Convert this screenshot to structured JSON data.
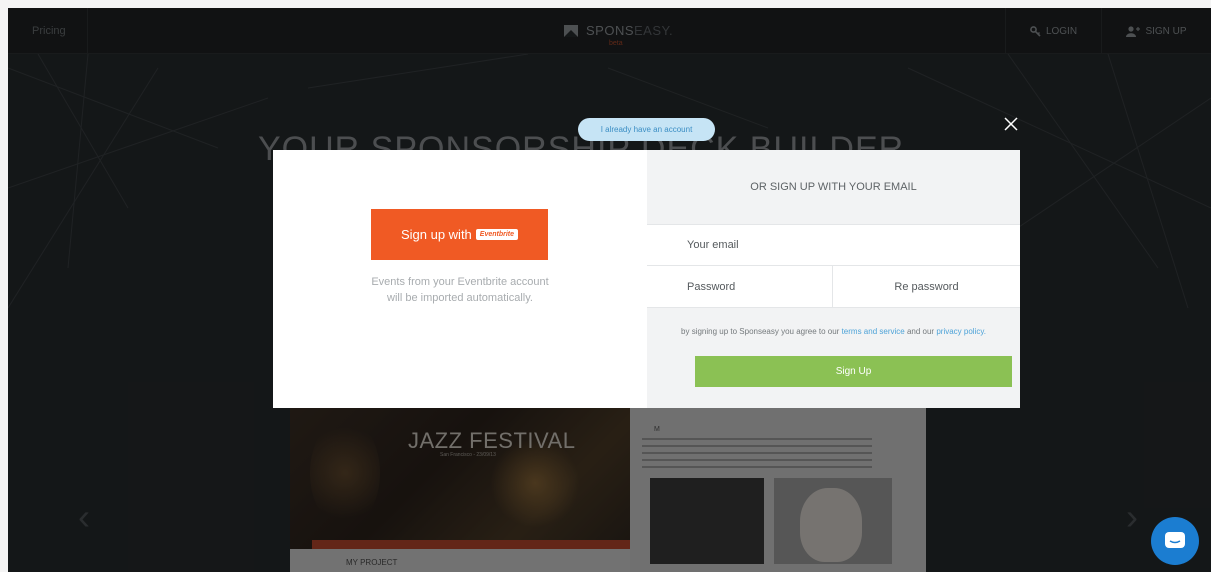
{
  "nav": {
    "pricing_label": "Pricing",
    "logo_text_bold": "SPONS",
    "logo_text_light": "EASY.",
    "logo_beta": "beta",
    "login_label": "LOGIN",
    "signup_label": "SIGN UP"
  },
  "hero": {
    "title": "YOUR SPONSORSHIP DECK BUILDER"
  },
  "preview": {
    "event_title": "JAZZ FESTIVAL",
    "event_subtitle": "San Francisco - 23/09/13",
    "project_label": "MY PROJECT"
  },
  "modal": {
    "already_account_label": "I already have an account",
    "eventbrite_button_label": "Sign up with",
    "eventbrite_badge": "Eventbrite",
    "eventbrite_desc_line1": "Events from your Eventbrite account",
    "eventbrite_desc_line2": "will be imported automatically.",
    "or_email_header": "OR SIGN UP WITH YOUR EMAIL",
    "email_placeholder": "Your email",
    "password_placeholder": "Password",
    "repassword_placeholder": "Re password",
    "terms_prefix": "by signing up to Sponseasy you agree to our",
    "terms_link": "terms and service",
    "terms_middle": "and our",
    "privacy_link": "privacy policy.",
    "signup_button_label": "Sign Up"
  },
  "colors": {
    "eventbrite_orange": "#f05a24",
    "signup_green": "#8bc154",
    "link_blue": "#4ea3d8",
    "chat_blue": "#1b7dd1"
  }
}
